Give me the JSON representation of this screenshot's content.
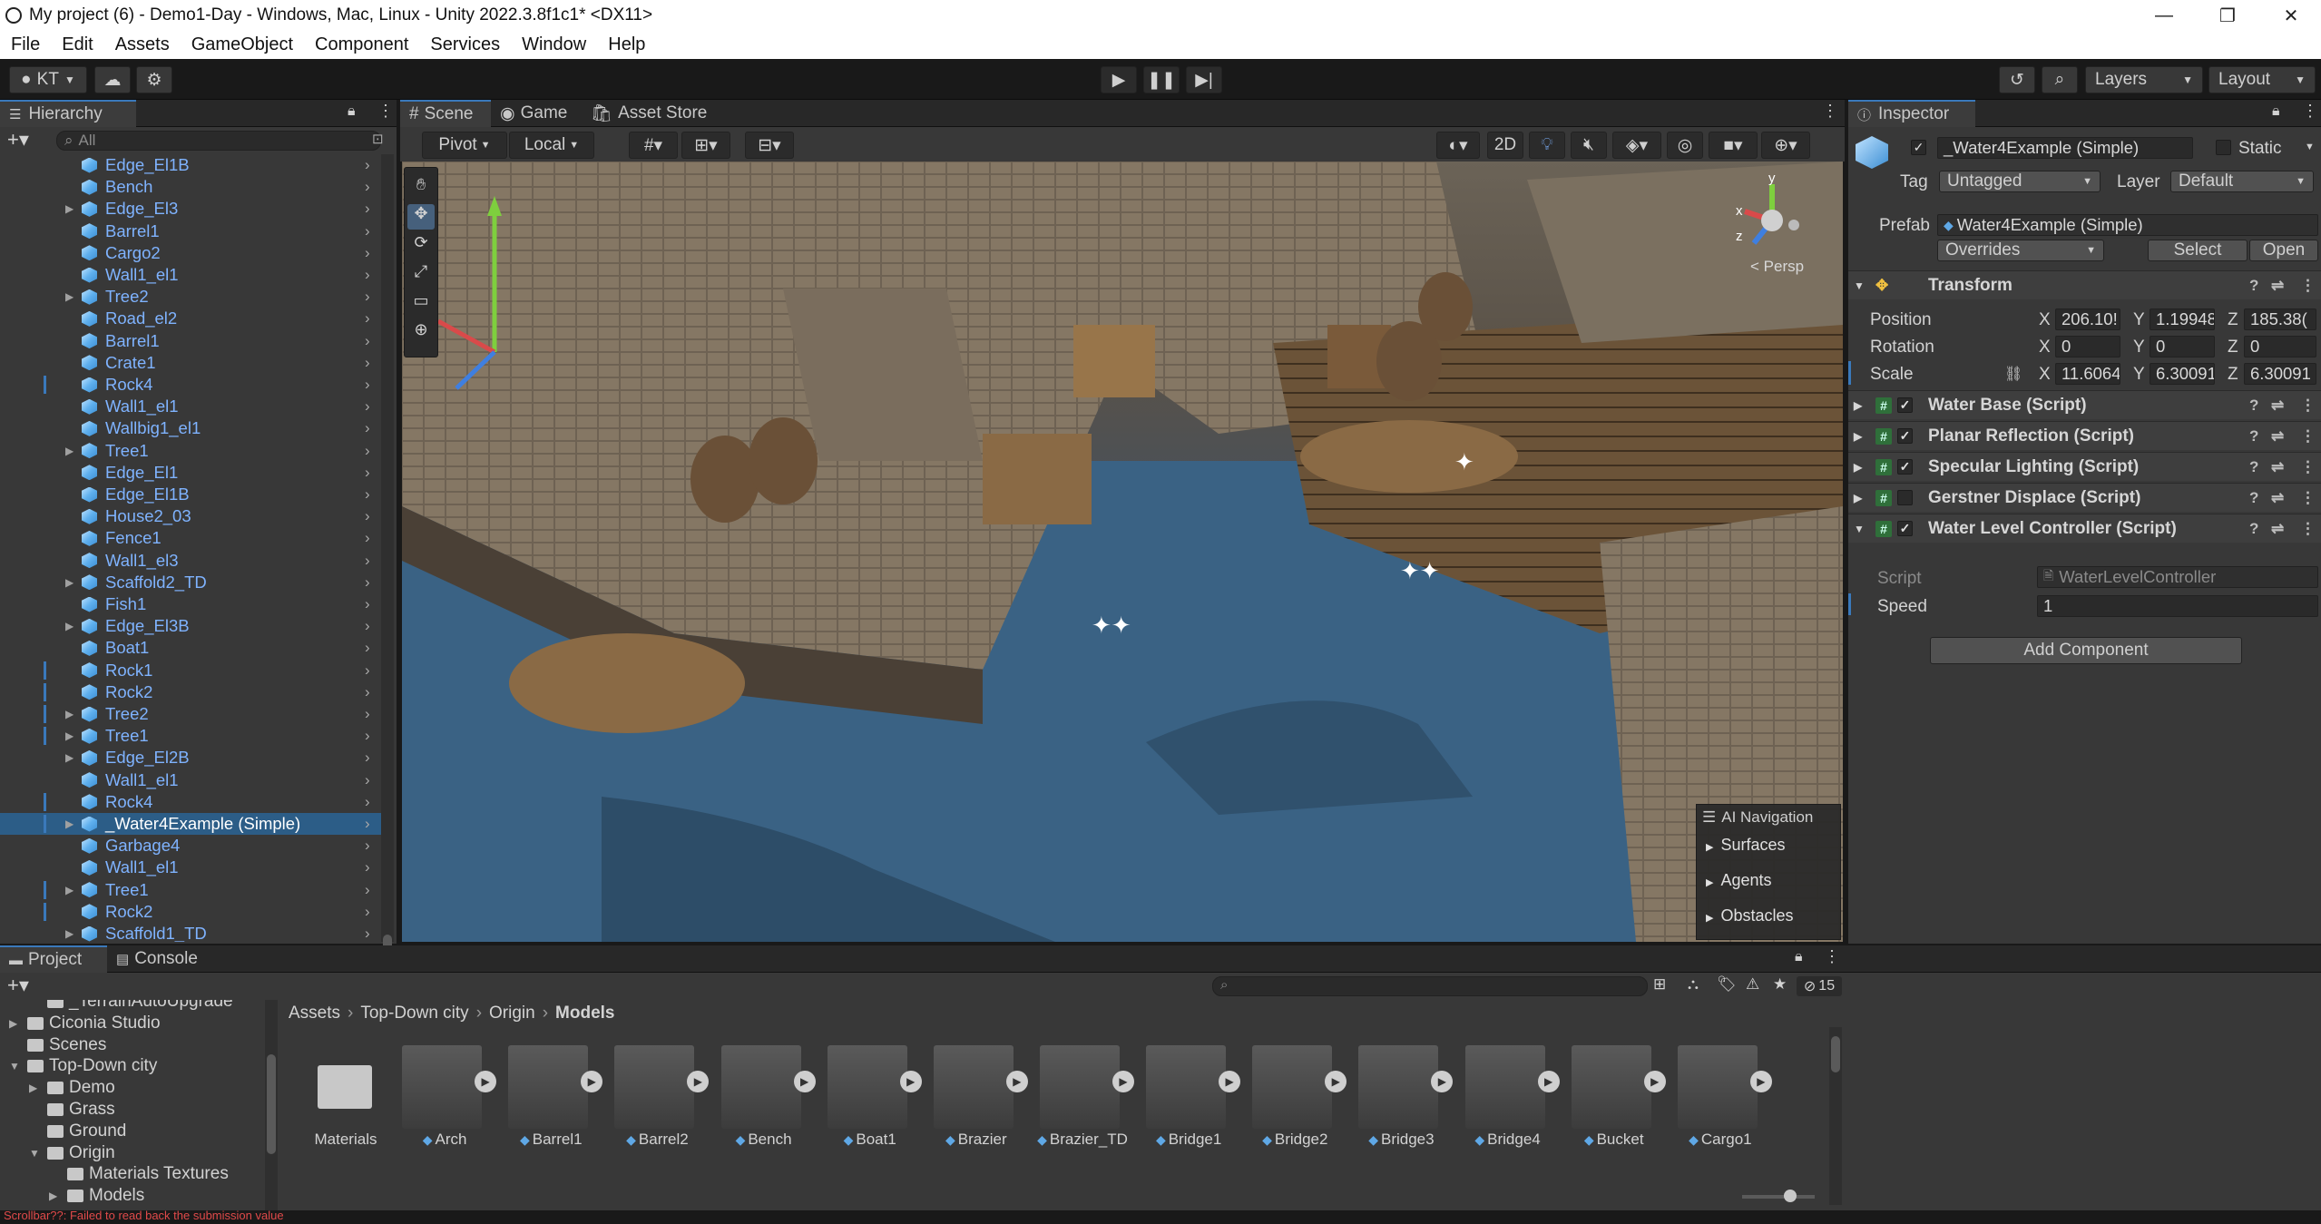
{
  "window": {
    "title": "My project (6) - Demo1-Day - Windows, Mac, Linux - Unity 2022.3.8f1c1* <DX11>",
    "controls": [
      "—",
      "❐",
      "✕"
    ]
  },
  "menu": [
    "File",
    "Edit",
    "Assets",
    "GameObject",
    "Component",
    "Services",
    "Window",
    "Help"
  ],
  "toolbar": {
    "account": "KT",
    "layers": "Layers",
    "layout": "Layout"
  },
  "hierarchy": {
    "tab": "Hierarchy",
    "search_placeholder": "All",
    "rows": [
      {
        "name": "Edge_El1B",
        "expand": false,
        "bar": false
      },
      {
        "name": "Bench",
        "expand": false,
        "bar": false
      },
      {
        "name": "Edge_El3",
        "expand": true,
        "bar": false
      },
      {
        "name": "Barrel1",
        "expand": false,
        "bar": false
      },
      {
        "name": "Cargo2",
        "expand": false,
        "bar": false
      },
      {
        "name": "Wall1_el1",
        "expand": false,
        "bar": false
      },
      {
        "name": "Tree2",
        "expand": true,
        "bar": false
      },
      {
        "name": "Road_el2",
        "expand": false,
        "bar": false
      },
      {
        "name": "Barrel1",
        "expand": false,
        "bar": false
      },
      {
        "name": "Crate1",
        "expand": false,
        "bar": false
      },
      {
        "name": "Rock4",
        "expand": false,
        "bar": true
      },
      {
        "name": "Wall1_el1",
        "expand": false,
        "bar": false
      },
      {
        "name": "Wallbig1_el1",
        "expand": false,
        "bar": false
      },
      {
        "name": "Tree1",
        "expand": true,
        "bar": false
      },
      {
        "name": "Edge_El1",
        "expand": false,
        "bar": false
      },
      {
        "name": "Edge_El1B",
        "expand": false,
        "bar": false
      },
      {
        "name": "House2_03",
        "expand": false,
        "bar": false
      },
      {
        "name": "Fence1",
        "expand": false,
        "bar": false
      },
      {
        "name": "Wall1_el3",
        "expand": false,
        "bar": false
      },
      {
        "name": "Scaffold2_TD",
        "expand": true,
        "bar": false
      },
      {
        "name": "Fish1",
        "expand": false,
        "bar": false
      },
      {
        "name": "Edge_El3B",
        "expand": true,
        "bar": false
      },
      {
        "name": "Boat1",
        "expand": false,
        "bar": false
      },
      {
        "name": "Rock1",
        "expand": false,
        "bar": true
      },
      {
        "name": "Rock2",
        "expand": false,
        "bar": true
      },
      {
        "name": "Tree2",
        "expand": true,
        "bar": true
      },
      {
        "name": "Tree1",
        "expand": true,
        "bar": true
      },
      {
        "name": "Edge_El2B",
        "expand": true,
        "bar": false
      },
      {
        "name": "Wall1_el1",
        "expand": false,
        "bar": false
      },
      {
        "name": "Rock4",
        "expand": false,
        "bar": true
      },
      {
        "name": "_Water4Example (Simple)",
        "expand": true,
        "bar": true,
        "selected": true
      },
      {
        "name": "Garbage4",
        "expand": false,
        "bar": false
      },
      {
        "name": "Wall1_el1",
        "expand": false,
        "bar": false
      },
      {
        "name": "Tree1",
        "expand": true,
        "bar": true
      },
      {
        "name": "Rock2",
        "expand": false,
        "bar": true
      },
      {
        "name": "Scaffold1_TD",
        "expand": true,
        "bar": false
      }
    ]
  },
  "scene": {
    "tabs": [
      "Scene",
      "Game",
      "Asset Store"
    ],
    "pivot": "Pivot",
    "local": "Local",
    "mode_2d": "2D",
    "persp": "< Persp",
    "gizmo_axes": {
      "x": "x",
      "y": "y",
      "z": "z"
    },
    "ai_navigation": {
      "title": "AI Navigation",
      "items": [
        "Surfaces",
        "Agents",
        "Obstacles"
      ]
    }
  },
  "inspector": {
    "tab": "Inspector",
    "object_name": "_Water4Example (Simple)",
    "static_label": "Static",
    "tag_label": "Tag",
    "tag_value": "Untagged",
    "layer_label": "Layer",
    "layer_value": "Default",
    "prefab_label": "Prefab",
    "prefab_value": "Water4Example (Simple)",
    "overrides": "Overrides",
    "select": "Select",
    "open": "Open",
    "transform": {
      "title": "Transform",
      "position": {
        "label": "Position",
        "x": "206.10!",
        "y": "1.19948",
        "z": "185.38("
      },
      "rotation": {
        "label": "Rotation",
        "x": "0",
        "y": "0",
        "z": "0"
      },
      "scale": {
        "label": "Scale",
        "x": "11.6064",
        "y": "6.30091",
        "z": "6.30091"
      }
    },
    "components": [
      {
        "name": "Water Base (Script)",
        "enabled": true
      },
      {
        "name": "Planar Reflection (Script)",
        "enabled": true
      },
      {
        "name": "Specular Lighting (Script)",
        "enabled": true
      },
      {
        "name": "Gerstner Displace (Script)",
        "enabled": false
      },
      {
        "name": "Water Level Controller (Script)",
        "enabled": true
      }
    ],
    "script_label": "Script",
    "script_value": "WaterLevelController",
    "speed_label": "Speed",
    "speed_value": "1",
    "add_component": "Add Component"
  },
  "project": {
    "tabs": [
      "Project",
      "Console"
    ],
    "hidden_count": "15",
    "breadcrumb": [
      "Assets",
      "Top-Down city",
      "Origin",
      "Models"
    ],
    "tree": [
      {
        "name": "_TerrainAutoUpgrade",
        "depth": 1,
        "arrow": ""
      },
      {
        "name": "Ciconia Studio",
        "depth": 0,
        "arrow": "▶"
      },
      {
        "name": "Scenes",
        "depth": 0,
        "arrow": ""
      },
      {
        "name": "Top-Down city",
        "depth": 0,
        "arrow": "▼"
      },
      {
        "name": "Demo",
        "depth": 1,
        "arrow": "▶"
      },
      {
        "name": "Grass",
        "depth": 1,
        "arrow": ""
      },
      {
        "name": "Ground",
        "depth": 1,
        "arrow": ""
      },
      {
        "name": "Origin",
        "depth": 1,
        "arrow": "▼"
      },
      {
        "name": "Materials Textures",
        "depth": 2,
        "arrow": ""
      },
      {
        "name": "Models",
        "depth": 2,
        "arrow": "▶"
      }
    ],
    "assets": [
      "Materials",
      "Arch",
      "Barrel1",
      "Barrel2",
      "Bench",
      "Boat1",
      "Brazier",
      "Brazier_TD",
      "Bridge1",
      "Bridge2",
      "Bridge3",
      "Bridge4",
      "Bucket",
      "Cargo1"
    ]
  },
  "status": {
    "message": "Scrollbar??: Failed to read back the submission value",
    "color": "#e04a4a"
  }
}
